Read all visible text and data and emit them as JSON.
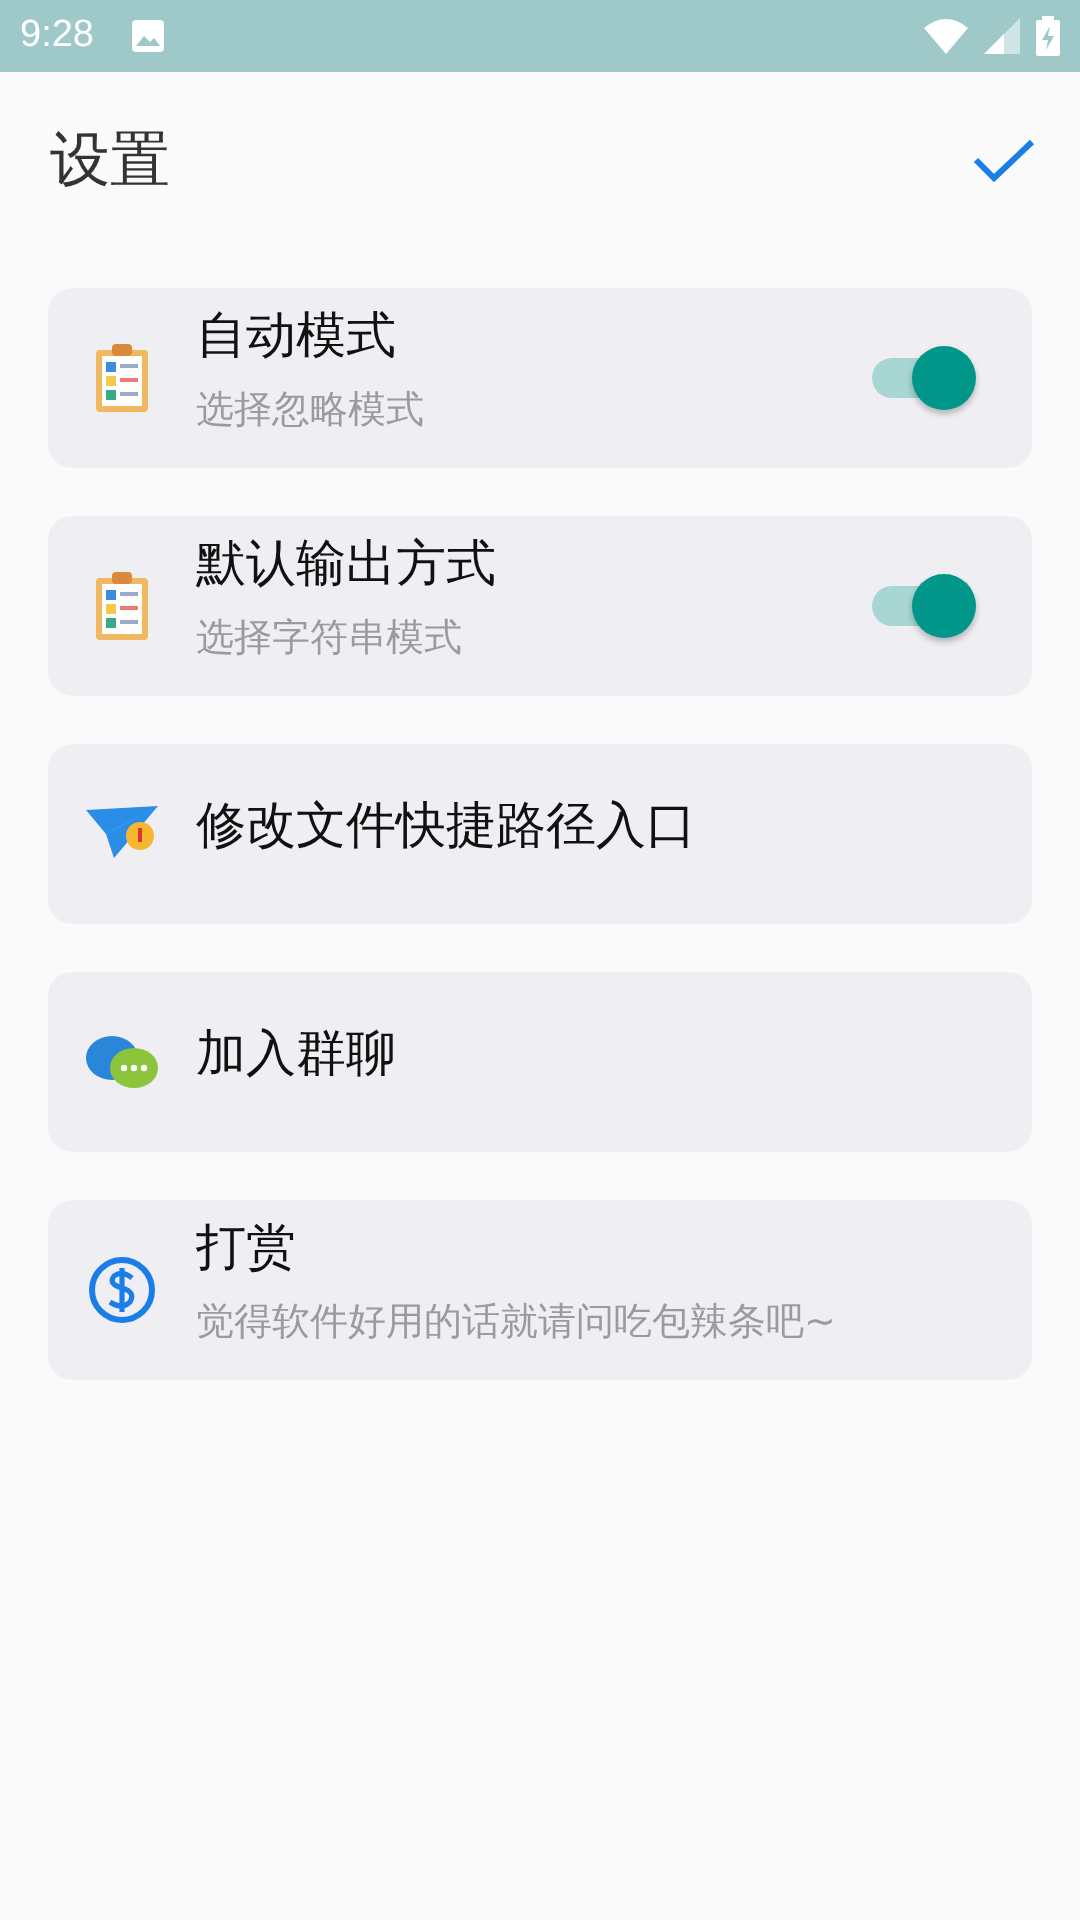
{
  "status_bar": {
    "time": "9:28"
  },
  "header": {
    "title": "设置"
  },
  "items": [
    {
      "kind": "toggle",
      "title": "自动模式",
      "subtitle": "选择忽略模式",
      "on": true
    },
    {
      "kind": "toggle",
      "title": "默认输出方式",
      "subtitle": "选择字符串模式",
      "on": true
    },
    {
      "kind": "link",
      "title": "修改文件快捷路径入口"
    },
    {
      "kind": "link",
      "title": "加入群聊"
    },
    {
      "kind": "link",
      "title": "打赏",
      "subtitle": "觉得软件好用的话就请问吃包辣条吧~"
    }
  ]
}
